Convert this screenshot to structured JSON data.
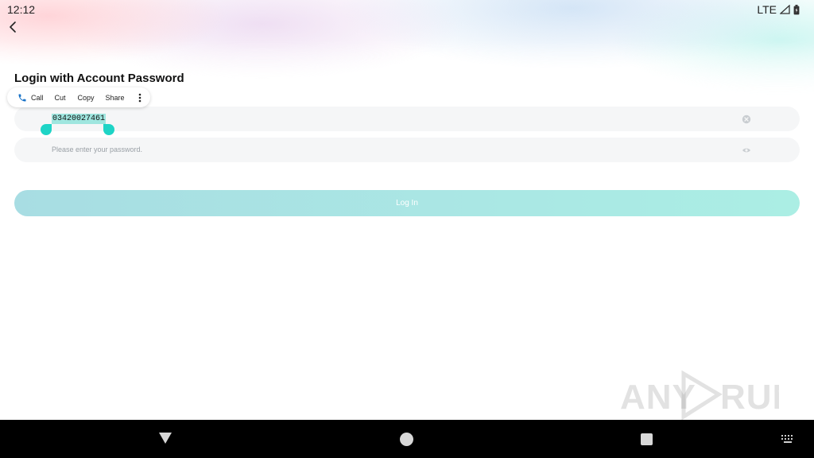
{
  "status_bar": {
    "time": "12:12",
    "network": "LTE"
  },
  "header": {
    "back_icon": "chevron-left-icon",
    "title": "Login with Account Password"
  },
  "context_menu": {
    "items": [
      {
        "label": "Call",
        "icon": "phone-icon"
      },
      {
        "label": "Cut"
      },
      {
        "label": "Copy"
      },
      {
        "label": "Share"
      }
    ],
    "more_icon": "more-vertical-icon"
  },
  "form": {
    "phone": {
      "value": "03420027461",
      "clear_icon": "clear-icon"
    },
    "password": {
      "placeholder": "Please enter your password.",
      "visibility_icon": "eye-icon"
    },
    "login_label": "Log In"
  },
  "colors": {
    "accent": "#1ed4c6",
    "selection": "#9fe6df",
    "button_gradient_start": "#a8dde3",
    "button_gradient_end": "#abeee4"
  },
  "watermark": "ANY RUN",
  "nav_bar": {
    "back_icon": "triangle-back-icon",
    "home_icon": "circle-home-icon",
    "recent_icon": "square-recent-icon",
    "keyboard_icon": "keyboard-icon"
  }
}
